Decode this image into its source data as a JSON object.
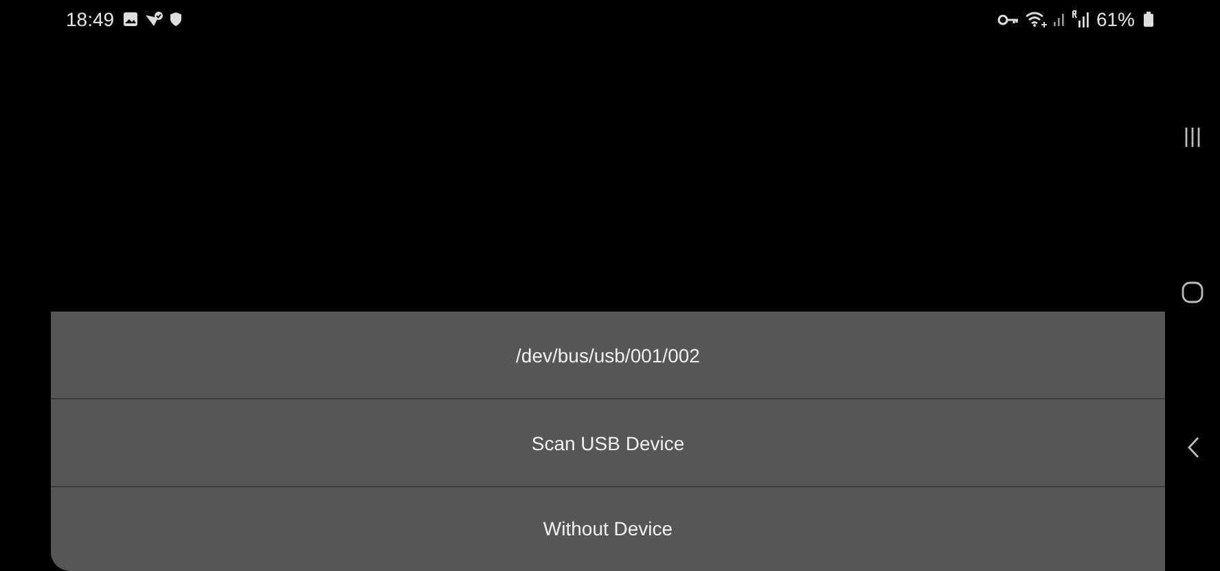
{
  "status_bar": {
    "time": "18:49",
    "battery": "61%"
  },
  "options": [
    {
      "label": "/dev/bus/usb/001/002"
    },
    {
      "label": "Scan USB Device"
    },
    {
      "label": "Without Device"
    }
  ]
}
